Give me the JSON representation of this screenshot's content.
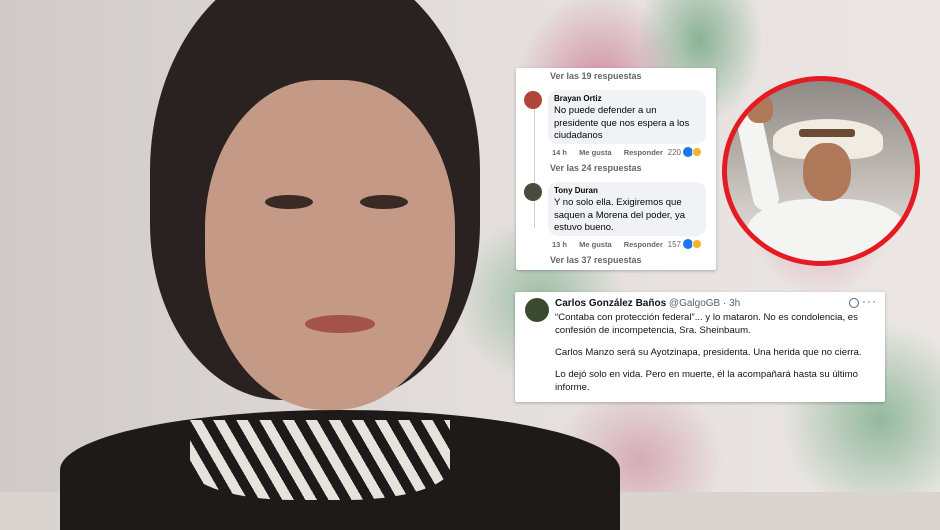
{
  "fb_comments": {
    "more_replies_top": "Ver las 19 respuestas",
    "comments": [
      {
        "author": "Brayan Ortiz",
        "text": "No puede defender a un presidente que nos espera a los ciudadanos",
        "time": "14 h",
        "like_label": "Me gusta",
        "reply_label": "Responder",
        "reaction_count": "220",
        "more_replies": "Ver las 24 respuestas"
      },
      {
        "author": "Tony Duran",
        "text": "Y no solo ella. Exigiremos que saquen a Morena del poder, ya estuvo bueno.",
        "time": "13 h",
        "like_label": "Me gusta",
        "reply_label": "Responder",
        "reaction_count": "157",
        "more_replies": "Ver las 37 respuestas"
      }
    ],
    "colors": {
      "bubble": "#f0f2f5",
      "meta": "#65676b",
      "like": "#1877f2",
      "haha": "#f7b125"
    }
  },
  "tweet": {
    "name": "Carlos González Baños",
    "handle": "@GalgoGB",
    "separator": "·",
    "time": "3h",
    "menu_icon": "···",
    "paragraphs": [
      "“Contaba con protección federal”... y lo mataron. No es condolencia, es confesión de incompetencia, Sra. Sheinbaum.",
      "Carlos Manzo será su Ayotzinapa, presidenta. Una herida que no cierra.",
      "Lo dejó solo en vida. Pero en muerte, él la acompañará hasta su último informe."
    ]
  },
  "photo_frame_color": "#e51b23"
}
